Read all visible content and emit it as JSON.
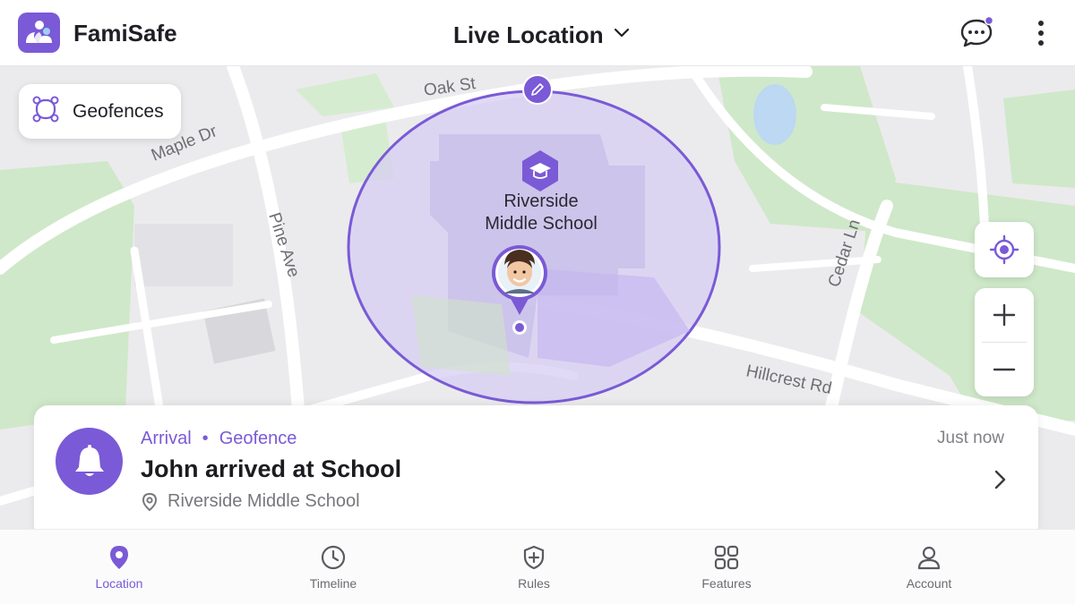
{
  "header": {
    "app_name": "FamiSafe",
    "title": "Live Location"
  },
  "map": {
    "streets": [
      "Oak St",
      "Maple Dr",
      "Pine Ave",
      "Cedar Ln",
      "Hillcrest Rd"
    ],
    "geofence_button": "Geofences",
    "geofence_place": "Riverside Middle School",
    "school_label_lines": [
      "Riverside",
      "Middle School"
    ]
  },
  "notification": {
    "type": "Arrival",
    "separator": "•",
    "category": "Geofence",
    "title": "John arrived at School",
    "place": "Riverside Middle School",
    "time": "Just now"
  },
  "bottom_nav": [
    {
      "label": "Location",
      "icon": "location-pin-icon",
      "active": true
    },
    {
      "label": "Timeline",
      "icon": "clock-icon",
      "active": false
    },
    {
      "label": "Rules",
      "icon": "shield-plus-icon",
      "active": false
    },
    {
      "label": "Features",
      "icon": "grid-icon",
      "active": false
    },
    {
      "label": "Account",
      "icon": "person-icon",
      "active": false
    }
  ],
  "colors": {
    "accent": "#7a5ad6",
    "map_background": "#ebebed",
    "park_green": "#cfe8c9",
    "geofence_fill": "#d7cdf3"
  }
}
